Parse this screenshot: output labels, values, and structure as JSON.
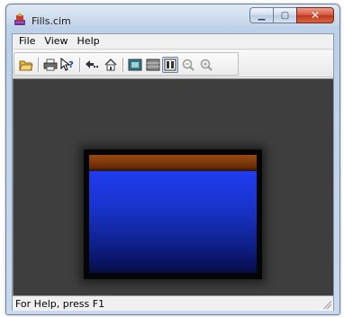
{
  "window": {
    "title": "Fills.cim",
    "app_icon": "paint-app-icon",
    "caption_buttons": [
      {
        "name": "minimize",
        "glyph": "▁"
      },
      {
        "name": "maximize",
        "glyph": "▢"
      },
      {
        "name": "close",
        "glyph": "✕"
      }
    ]
  },
  "menu": {
    "items": [
      "File",
      "View",
      "Help"
    ]
  },
  "toolbar": {
    "buttons": [
      {
        "name": "open-icon",
        "pressed": false
      },
      {
        "name": "print-icon",
        "pressed": false
      },
      {
        "name": "help-pointer-icon",
        "pressed": false
      },
      {
        "name": "back-arrow-icon",
        "pressed": false
      },
      {
        "name": "home-icon",
        "pressed": false
      },
      {
        "name": "fit-view-icon",
        "pressed": false
      },
      {
        "name": "grid-view-icon",
        "pressed": false
      },
      {
        "name": "actual-size-icon",
        "pressed": true
      },
      {
        "name": "zoom-out-icon",
        "pressed": false
      },
      {
        "name": "zoom-in-icon",
        "pressed": false
      }
    ]
  },
  "canvas": {
    "background": "#3e3e3e",
    "fill_top_color": "#7a3508",
    "fill_main_color_top": "#1e3cf0",
    "fill_main_color_bottom": "#060d47"
  },
  "status": {
    "text": "For Help, press F1"
  }
}
